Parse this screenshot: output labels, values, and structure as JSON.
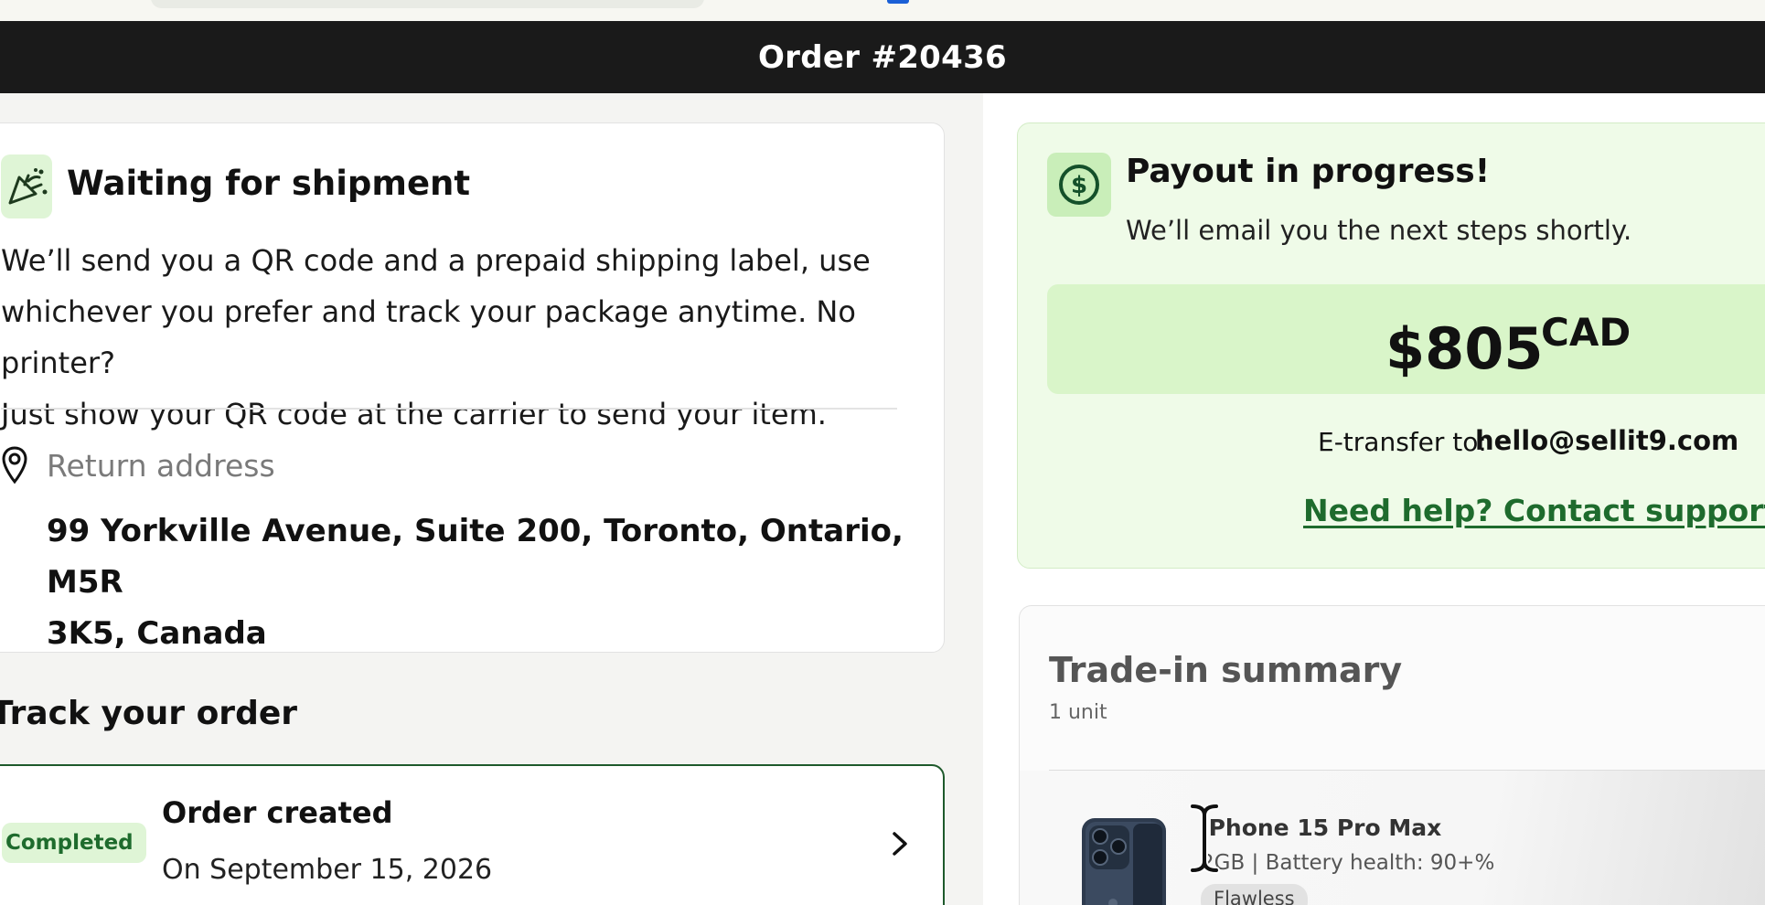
{
  "header": {
    "title": "Order #20436"
  },
  "shipment": {
    "icon": "party-popper-icon",
    "title": "Waiting for shipment",
    "body_lines": [
      "We’ll send you a QR code and a prepaid shipping label, use",
      "whichever you prefer and track your package anytime. No printer?",
      "Just show your QR code at the carrier to send your item."
    ],
    "return_label": "Return address",
    "return_address_lines": [
      "99 Yorkville Avenue, Suite 200, Toronto, Ontario, M5R",
      "3K5, Canada"
    ]
  },
  "tracking": {
    "title": "Track your order",
    "steps": [
      {
        "status": "Completed",
        "title": "Order created",
        "date": "On September 15, 2026"
      }
    ]
  },
  "payout": {
    "icon": "dollar-circle-icon",
    "title": "Payout in progress!",
    "subtitle": "We’ll email you the next steps shortly.",
    "amount": "$805",
    "currency": "CAD",
    "etransfer_label": "E-transfer to:",
    "etransfer_email": "hello@sellit9.com",
    "help_link": "Need help? Contact support"
  },
  "summary": {
    "title": "Trade-in summary",
    "units": "1 unit",
    "items": [
      {
        "name": "iPhone 15 Pro Max",
        "specs": "2GB | Battery health: 90+%",
        "condition": "Flawless"
      }
    ]
  },
  "colors": {
    "header_bg": "#1a1a1a",
    "accent_green": "#1e6b2d",
    "payout_bg": "#effbe8",
    "amount_bg": "#d9f5c9",
    "badge_bg": "#dff5d6"
  }
}
